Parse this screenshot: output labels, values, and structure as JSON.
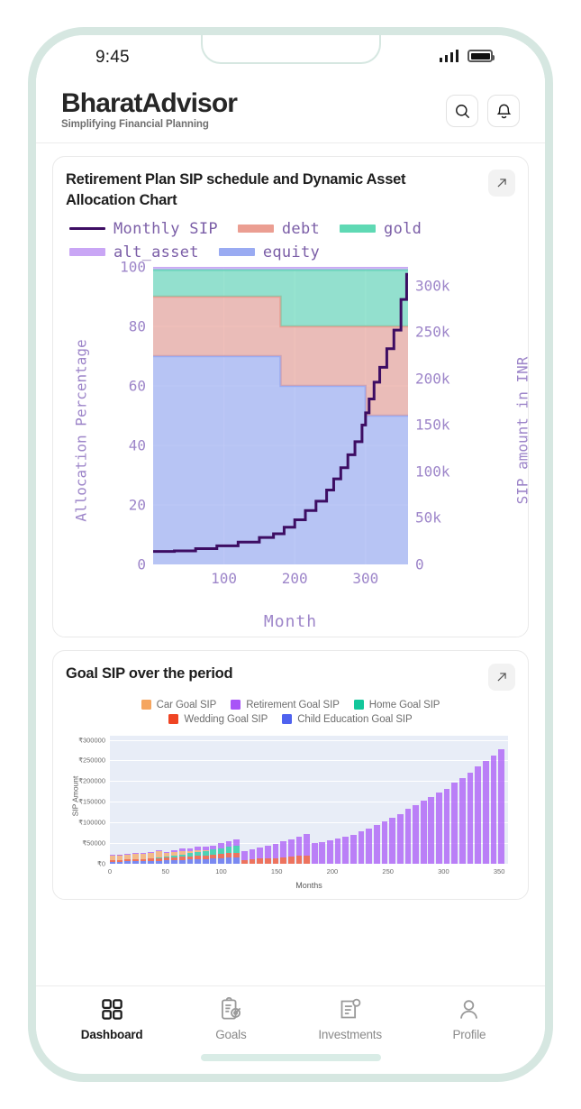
{
  "status_bar": {
    "time": "9:45",
    "signal_icon": "signal-bars-icon",
    "battery_icon": "battery-icon"
  },
  "header": {
    "brand": "BharatAdvisor",
    "tagline": "Simplifying Financial Planning",
    "search_icon": "search-icon",
    "bell_icon": "bell-icon"
  },
  "cards": [
    {
      "title": "Retirement Plan SIP schedule and Dynamic Asset Allocation Chart",
      "expand_icon": "expand-arrow-icon"
    },
    {
      "title": "Goal SIP over the period",
      "expand_icon": "expand-arrow-icon"
    }
  ],
  "bottom_nav": [
    {
      "label": "Dashboard",
      "icon": "grid-icon",
      "active": true
    },
    {
      "label": "Goals",
      "icon": "clipboard-target-icon",
      "active": false
    },
    {
      "label": "Investments",
      "icon": "document-list-icon",
      "active": false
    },
    {
      "label": "Profile",
      "icon": "person-icon",
      "active": false
    }
  ],
  "chart_data": [
    {
      "type": "area",
      "title": "Retirement Plan SIP schedule and Dynamic Asset Allocation Chart",
      "xlabel": "Month",
      "ylabel": "Allocation Percentage",
      "y2label": "SIP amount in INR",
      "xlim": [
        0,
        360
      ],
      "ylim": [
        0,
        100
      ],
      "y2lim": [
        0,
        320000
      ],
      "grid": true,
      "legend_position": "top",
      "xticks": [
        100,
        200,
        300
      ],
      "yticks": [
        0,
        20,
        40,
        60,
        80,
        100
      ],
      "y2ticks": [
        "0",
        "50k",
        "100k",
        "150k",
        "200k",
        "250k",
        "300k"
      ],
      "y2tick_values": [
        0,
        50000,
        100000,
        150000,
        200000,
        250000,
        300000
      ],
      "colors": {
        "equity": "#9aabf2",
        "debt": "#eb9e92",
        "gold": "#5fd9b4",
        "alt_asset": "#c9a6f5",
        "monthly_sip": "#3d0d63"
      },
      "stack_order": [
        "equity",
        "debt",
        "gold",
        "alt_asset"
      ],
      "series": [
        {
          "name": "equity",
          "type": "step-area",
          "x": [
            0,
            180,
            300,
            360
          ],
          "values": [
            70,
            60,
            50,
            50
          ]
        },
        {
          "name": "debt",
          "type": "step-area",
          "x": [
            0,
            180,
            300,
            360
          ],
          "values": [
            20,
            20,
            30,
            30
          ]
        },
        {
          "name": "gold",
          "type": "step-area",
          "x": [
            0,
            180,
            300,
            360
          ],
          "values": [
            9,
            19,
            19,
            19
          ]
        },
        {
          "name": "alt_asset",
          "type": "step-area",
          "x": [
            0,
            180,
            300,
            360
          ],
          "values": [
            1,
            1,
            1,
            1
          ]
        },
        {
          "name": "Monthly SIP",
          "type": "step-line",
          "axis": "right",
          "x": [
            0,
            30,
            60,
            90,
            120,
            150,
            170,
            185,
            200,
            215,
            230,
            245,
            255,
            265,
            275,
            285,
            295,
            300,
            305,
            312,
            320,
            330,
            340,
            350,
            358
          ],
          "values": [
            14000,
            14500,
            17000,
            20000,
            24000,
            29000,
            33000,
            40000,
            48000,
            58000,
            68000,
            80000,
            92000,
            104000,
            118000,
            132000,
            150000,
            163000,
            178000,
            196000,
            212000,
            232000,
            252000,
            285000,
            312000
          ]
        }
      ]
    },
    {
      "type": "bar",
      "title": "Goal SIP over the period",
      "xlabel": "Months",
      "ylabel": "SIP Amount",
      "xlim": [
        0,
        358
      ],
      "ylim": [
        0,
        310000
      ],
      "grid": true,
      "legend_position": "top",
      "stacked": true,
      "xticks": [
        0,
        50,
        100,
        150,
        200,
        250,
        300,
        350
      ],
      "yticks": [
        "₹0",
        "₹50000",
        "₹100000",
        "₹150000",
        "₹200000",
        "₹250000",
        "₹300000"
      ],
      "ytick_values": [
        0,
        50000,
        100000,
        150000,
        200000,
        250000,
        300000
      ],
      "legend": [
        {
          "name": "Car Goal SIP",
          "color": "#f5a55f"
        },
        {
          "name": "Retirement Goal SIP",
          "color": "#a855f7"
        },
        {
          "name": "Home Goal SIP",
          "color": "#12c79b"
        },
        {
          "name": "Wedding Goal SIP",
          "color": "#ef4423"
        },
        {
          "name": "Child Education Goal SIP",
          "color": "#4f62ef"
        }
      ],
      "x": [
        2,
        9,
        16,
        23,
        30,
        37,
        44,
        51,
        58,
        65,
        72,
        79,
        86,
        93,
        100,
        107,
        114,
        121,
        128,
        135,
        142,
        149,
        156,
        163,
        170,
        177,
        184,
        191,
        198,
        205,
        212,
        219,
        226,
        233,
        240,
        247,
        254,
        261,
        268,
        275,
        282,
        289,
        296,
        303,
        310,
        317,
        324,
        331,
        338,
        345,
        352
      ],
      "series": [
        {
          "name": "Car Goal SIP",
          "color": "#f5a55f",
          "values": [
            11000,
            11500,
            12000,
            12500,
            13000,
            14000,
            15000,
            8000,
            8500,
            9000,
            5000,
            5500,
            2000,
            0,
            0,
            0,
            0,
            0,
            0,
            0,
            0,
            0,
            0,
            0,
            0,
            0,
            0,
            0,
            0,
            0,
            0,
            0,
            0,
            0,
            0,
            0,
            0,
            0,
            0,
            0,
            0,
            0,
            0,
            0,
            0,
            0,
            0,
            0,
            0,
            0,
            0
          ]
        },
        {
          "name": "Wedding Goal SIP",
          "color": "#ef4423",
          "values": [
            4000,
            4200,
            4500,
            4800,
            5000,
            5400,
            5800,
            6200,
            6700,
            7200,
            7800,
            8400,
            9000,
            9700,
            10400,
            11200,
            12000,
            9000,
            11000,
            12000,
            13000,
            14000,
            15500,
            17000,
            18500,
            20000,
            0,
            0,
            0,
            0,
            0,
            0,
            0,
            0,
            0,
            0,
            0,
            0,
            0,
            0,
            0,
            0,
            0,
            0,
            0,
            0,
            0,
            0,
            0,
            0,
            0
          ]
        },
        {
          "name": "Home Goal SIP",
          "color": "#12c79b",
          "values": [
            0,
            0,
            0,
            0,
            0,
            0,
            1500,
            3000,
            4500,
            6000,
            7500,
            9000,
            10500,
            12000,
            13500,
            15000,
            16500,
            0,
            0,
            0,
            0,
            0,
            0,
            0,
            0,
            0,
            0,
            0,
            0,
            0,
            0,
            0,
            0,
            0,
            0,
            0,
            0,
            0,
            0,
            0,
            0,
            0,
            0,
            0,
            0,
            0,
            0,
            0,
            0,
            0,
            0
          ]
        },
        {
          "name": "Child Education Goal SIP",
          "color": "#4f62ef",
          "values": [
            5000,
            5300,
            5700,
            6100,
            6500,
            7000,
            7500,
            8100,
            8700,
            9300,
            10000,
            10700,
            11500,
            12300,
            13200,
            14100,
            15100,
            0,
            0,
            0,
            0,
            0,
            0,
            0,
            0,
            0,
            0,
            0,
            0,
            0,
            0,
            0,
            0,
            0,
            0,
            0,
            0,
            0,
            0,
            0,
            0,
            0,
            0,
            0,
            0,
            0,
            0,
            0,
            0,
            0,
            0
          ]
        },
        {
          "name": "Retirement Goal SIP",
          "color": "#a855f7",
          "values": [
            1000,
            1200,
            1500,
            1800,
            2100,
            2500,
            3000,
            3500,
            4200,
            5000,
            6000,
            7000,
            8500,
            10000,
            12000,
            14000,
            16000,
            21000,
            24000,
            27000,
            30000,
            34000,
            38000,
            42000,
            47000,
            52000,
            50000,
            52000,
            57000,
            60000,
            65000,
            70000,
            78000,
            86000,
            94000,
            102000,
            112000,
            120000,
            133000,
            142000,
            152000,
            162000,
            172000,
            182000,
            196000,
            208000,
            220000,
            236000,
            248000,
            262000,
            278000
          ]
        }
      ]
    }
  ]
}
